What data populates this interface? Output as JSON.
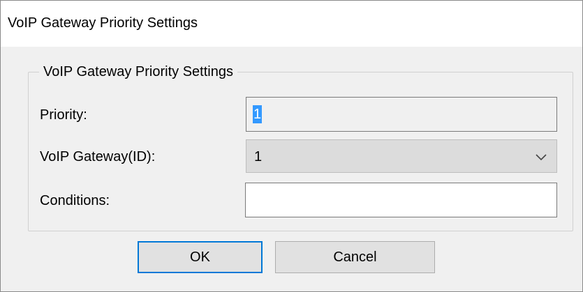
{
  "window": {
    "title": "VoIP Gateway Priority Settings"
  },
  "group": {
    "legend": "VoIP Gateway Priority Settings"
  },
  "fields": {
    "priority": {
      "label": "Priority:",
      "value": "1"
    },
    "gateway": {
      "label": "VoIP Gateway(ID):",
      "selected": "1"
    },
    "conditions": {
      "label": "Conditions:",
      "value": ""
    }
  },
  "buttons": {
    "ok_label": "OK",
    "cancel_label": "Cancel"
  },
  "icons": {
    "dropdown": "chevron-down-icon"
  },
  "colors": {
    "selection": "#3399ff",
    "focus_border": "#0078d7",
    "dialog_background": "#f0f0f0"
  }
}
